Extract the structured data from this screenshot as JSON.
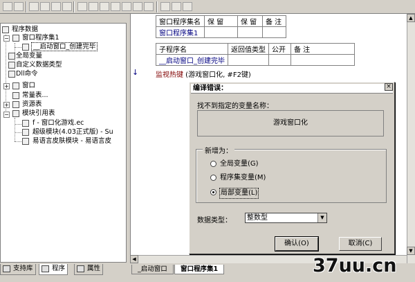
{
  "tree": {
    "items": [
      {
        "label": "程序数据",
        "level": 0
      },
      {
        "label": "窗口程序集1",
        "level": 1
      },
      {
        "label": "__启动窗口_创建完毕",
        "level": 2
      },
      {
        "label": "全局变量",
        "level": 1
      },
      {
        "label": "自定义数据类型",
        "level": 1
      },
      {
        "label": "Dll命令",
        "level": 1
      },
      {
        "label": "窗口",
        "level": 0
      },
      {
        "label": "常量表...",
        "level": 0
      },
      {
        "label": "资源表",
        "level": 0
      },
      {
        "label": "模块引用表",
        "level": 0
      },
      {
        "label": "f - 窗口化游戏.ec",
        "level": 1
      },
      {
        "label": "超级模块(4.03正式版) - Su",
        "level": 1
      },
      {
        "label": "易语言皮肤模块 - 易语言皮",
        "level": 1
      }
    ]
  },
  "left_tabs": [
    "支持库",
    "程序",
    "属性"
  ],
  "editor": {
    "assembly_table": {
      "headers": [
        "窗口程序集名",
        "保 留",
        "保 留",
        "备 注"
      ],
      "row": [
        "窗口程序集1",
        "",
        "",
        ""
      ]
    },
    "sub_table": {
      "headers": [
        "子程序名",
        "返回值类型",
        "公开",
        "备 注"
      ],
      "row": [
        "__启动窗口_创建完毕",
        "",
        "",
        ""
      ]
    },
    "code_line": {
      "keyword": "监视热键",
      "args": " (游戏窗口化, #F2键)"
    }
  },
  "bottom_tabs": [
    "_启动窗口",
    "窗口程序集1"
  ],
  "dialog": {
    "title": "编译错误：",
    "close": "×",
    "message": "找不到指定的变量名称：",
    "variable_name": "游戏窗口化",
    "group_title": "新增为：",
    "options": [
      {
        "label": "全局变量(G)",
        "checked": false
      },
      {
        "label": "程序集变量(M)",
        "checked": false
      },
      {
        "label": "局部变量(L)",
        "checked": true
      }
    ],
    "type_label": "数据类型：",
    "type_value": "整数型",
    "ok_label": "确认(O)",
    "cancel_label": "取消(C)"
  },
  "watermark": "37uu.cn"
}
